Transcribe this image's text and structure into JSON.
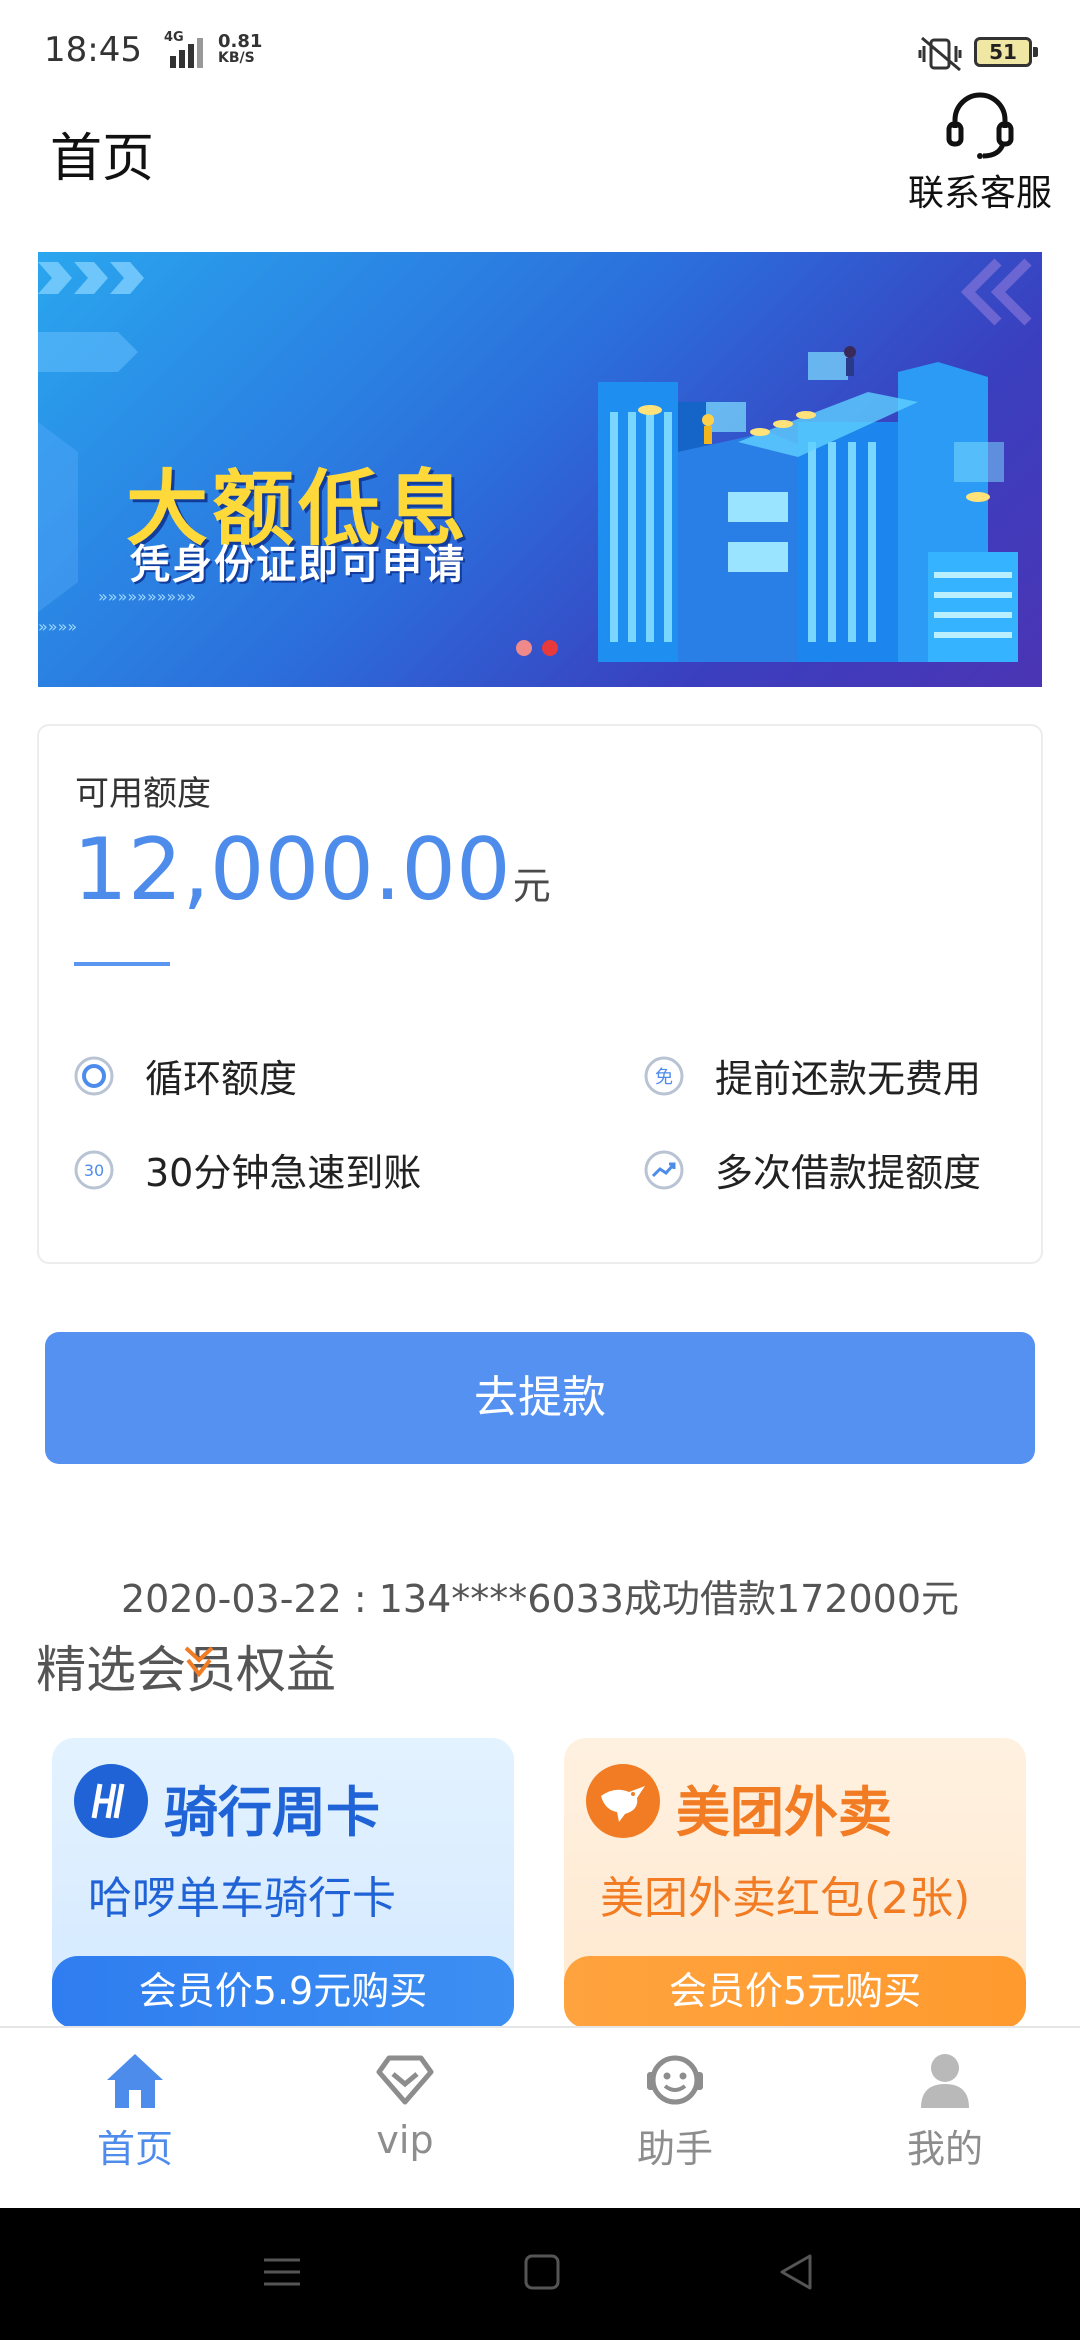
{
  "status_bar": {
    "time": "18:45",
    "network": "4G",
    "speed_value": "0.81",
    "speed_unit": "KB/S",
    "battery": "51"
  },
  "header": {
    "title": "首页",
    "service_label": "联系客服",
    "service_icon": "headset-icon"
  },
  "banner": {
    "headline": "大额低息",
    "subline": "凭身份证即可申请",
    "dots": [
      "inactive",
      "active"
    ],
    "colors": {
      "headline": "#ffd93a",
      "dot_active": "#e83a3a",
      "dot_inactive": "#f08a8a"
    }
  },
  "credit": {
    "label": "可用额度",
    "amount": "12,000.00",
    "unit": "元",
    "features": [
      {
        "icon": "circle-target-icon",
        "label": "循环额度"
      },
      {
        "icon": "free-badge-icon",
        "label": "提前还款无费用"
      },
      {
        "icon": "thirty-minutes-icon",
        "label": "30分钟急速到账"
      },
      {
        "icon": "trend-up-icon",
        "label": "多次借款提额度"
      }
    ]
  },
  "withdraw_button": "去提款",
  "ticker": "2020-03-22 : 134****6033成功借款172000元",
  "member_section": {
    "title": "精选会员权益",
    "cards": [
      {
        "title": "骑行周卡",
        "subtitle": "哈啰单车骑行卡",
        "button": "会员价5.9元购买",
        "logo": "hello-bike-logo"
      },
      {
        "title": "美团外卖",
        "subtitle": "美团外卖红包(2张)",
        "button": "会员价5元购买",
        "logo": "meituan-kangaroo-logo"
      }
    ]
  },
  "bottom_nav": [
    {
      "label": "首页",
      "icon": "home-icon",
      "active": true
    },
    {
      "label": "vip",
      "icon": "vip-diamond-icon",
      "active": false
    },
    {
      "label": "助手",
      "icon": "assistant-face-icon",
      "active": false
    },
    {
      "label": "我的",
      "icon": "user-icon",
      "active": false
    }
  ],
  "accent_color": "#4e8cec"
}
